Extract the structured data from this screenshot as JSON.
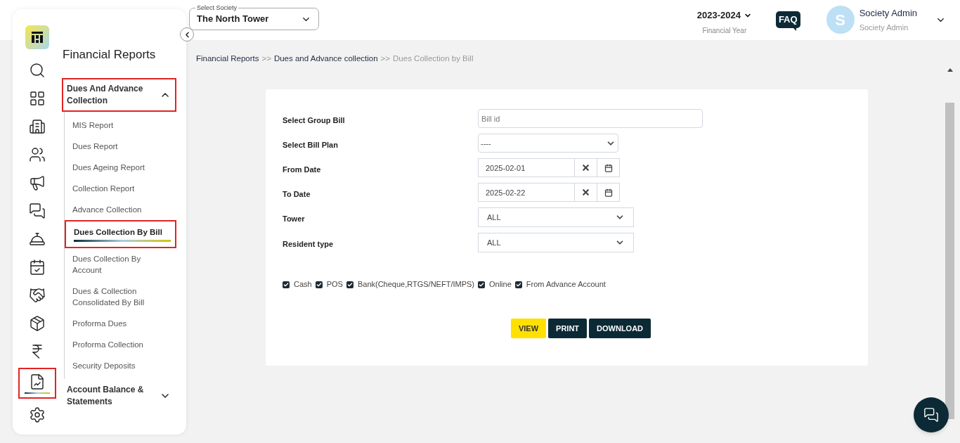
{
  "rail": {
    "items": [
      {
        "kind": "search",
        "selected": false,
        "highlighted": false
      },
      {
        "kind": "dashboard",
        "selected": false,
        "highlighted": false
      },
      {
        "kind": "building",
        "selected": false,
        "highlighted": false
      },
      {
        "kind": "people",
        "selected": false,
        "highlighted": false
      },
      {
        "kind": "megaphone",
        "selected": false,
        "highlighted": false
      },
      {
        "kind": "chat",
        "selected": false,
        "highlighted": false
      },
      {
        "kind": "desk",
        "selected": false,
        "highlighted": false
      },
      {
        "kind": "calendar",
        "selected": false,
        "highlighted": false
      },
      {
        "kind": "handshake",
        "selected": false,
        "highlighted": false
      },
      {
        "kind": "box",
        "selected": false,
        "highlighted": false
      },
      {
        "kind": "rupee",
        "selected": false,
        "highlighted": false
      },
      {
        "kind": "report",
        "selected": true,
        "highlighted": true
      },
      {
        "kind": "settings",
        "selected": false,
        "highlighted": false
      }
    ]
  },
  "nav": {
    "title": "Financial Reports",
    "groups": [
      {
        "label": "Dues And Advance Collection",
        "expanded": true,
        "highlighted": true,
        "children": [
          {
            "label": "MIS Report",
            "selected": false,
            "highlighted": false
          },
          {
            "label": "Dues Report",
            "selected": false,
            "highlighted": false
          },
          {
            "label": "Dues Ageing Report",
            "selected": false,
            "highlighted": false
          },
          {
            "label": "Collection Report",
            "selected": false,
            "highlighted": false
          },
          {
            "label": "Advance Collection",
            "selected": false,
            "highlighted": false
          },
          {
            "label": "Dues Collection By Bill",
            "selected": true,
            "highlighted": true
          },
          {
            "label": "Dues Collection By Account",
            "selected": false,
            "highlighted": false
          },
          {
            "label": "Dues & Collection Consolidated By Bill",
            "selected": false,
            "highlighted": false
          },
          {
            "label": "Proforma Dues",
            "selected": false,
            "highlighted": false
          },
          {
            "label": "Proforma Collection",
            "selected": false,
            "highlighted": false
          },
          {
            "label": "Security Deposits",
            "selected": false,
            "highlighted": false
          }
        ]
      },
      {
        "label": "Account Balance & Statements",
        "expanded": false,
        "highlighted": false
      }
    ]
  },
  "header": {
    "society": {
      "label": "Select Society",
      "value": "The North Tower"
    },
    "year": {
      "value": "2023-2024",
      "caption": "Financial Year"
    },
    "faq": "FAQ",
    "user": {
      "initial": "S",
      "name": "Society Admin",
      "role": "Society Admin"
    }
  },
  "breadcrumb": [
    {
      "label": "Financial Reports",
      "current": false
    },
    {
      "label": "Dues and Advance collection",
      "current": false
    },
    {
      "label": "Dues Collection by Bill",
      "current": true
    }
  ],
  "breadcrumb_separator": ">>",
  "form": {
    "fields": [
      {
        "kind": "text",
        "label": "Select Group Bill",
        "placeholder": "Bill id"
      },
      {
        "kind": "plan",
        "label": "Select Bill Plan",
        "value": "----"
      },
      {
        "kind": "date",
        "label": "From Date",
        "value": "2025-02-01"
      },
      {
        "kind": "date",
        "label": "To Date",
        "value": "2025-02-22"
      },
      {
        "kind": "select",
        "label": "Tower",
        "value": "ALL"
      },
      {
        "kind": "select",
        "label": "Resident type",
        "value": "ALL"
      }
    ],
    "payment_modes": [
      {
        "label": "Cash",
        "checked": true
      },
      {
        "label": "POS",
        "checked": true
      },
      {
        "label": "Bank(Cheque,RTGS/NEFT/IMPS)",
        "checked": true
      },
      {
        "label": "Online",
        "checked": true
      },
      {
        "label": "From Advance Account",
        "checked": true
      }
    ],
    "buttons": [
      {
        "label": "VIEW",
        "kind": "primary"
      },
      {
        "label": "PRINT",
        "kind": "dark"
      },
      {
        "label": "DOWNLOAD",
        "kind": "dark"
      }
    ]
  }
}
